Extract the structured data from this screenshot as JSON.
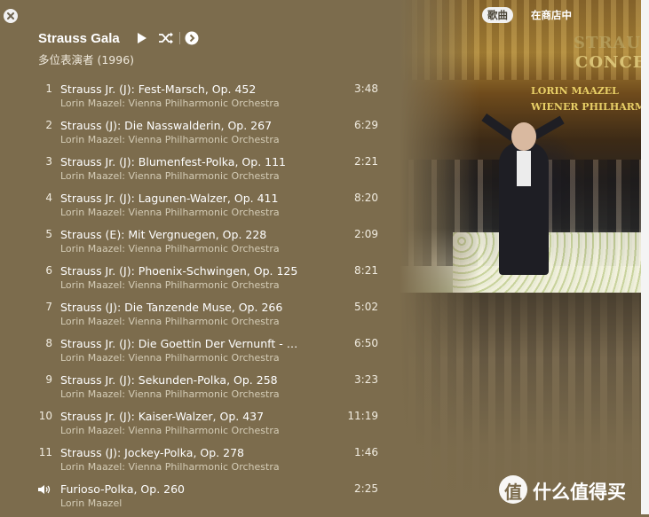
{
  "window": {
    "close_icon": "close-icon",
    "view_toggle": {
      "songs_label": "歌曲",
      "store_label": "在商店中"
    }
  },
  "album": {
    "title": "Strauss Gala",
    "subtitle": "多位表演者 (1996)",
    "art": {
      "title_line_1": "STRAUSS",
      "title_line_2": "CONCE",
      "credit_line_1": "LORIN MAAZEL",
      "credit_line_2": "WIENER PHILHARMONI"
    },
    "controls": {
      "play_icon": "play-icon",
      "shuffle_icon": "shuffle-icon",
      "next_icon": "chevron-right-circle-icon"
    }
  },
  "tracks": [
    {
      "number": "1",
      "title": "Strauss Jr. (J): Fest-Marsch, Op. 452",
      "artist": "Lorin Maazel: Vienna Philharmonic Orchestra",
      "duration": "3:48"
    },
    {
      "number": "2",
      "title": "Strauss (J): Die Nasswalderin, Op. 267",
      "artist": "Lorin Maazel: Vienna Philharmonic Orchestra",
      "duration": "6:29"
    },
    {
      "number": "3",
      "title": "Strauss Jr. (J): Blumenfest-Polka, Op. 111",
      "artist": "Lorin Maazel: Vienna Philharmonic Orchestra",
      "duration": "2:21"
    },
    {
      "number": "4",
      "title": "Strauss Jr. (J): Lagunen-Walzer, Op. 411",
      "artist": "Lorin Maazel: Vienna Philharmonic Orchestra",
      "duration": "8:20"
    },
    {
      "number": "5",
      "title": "Strauss (E): Mit Vergnuegen, Op. 228",
      "artist": "Lorin Maazel: Vienna Philharmonic Orchestra",
      "duration": "2:09"
    },
    {
      "number": "6",
      "title": "Strauss Jr. (J): Phoenix-Schwingen, Op. 125",
      "artist": "Lorin Maazel: Vienna Philharmonic Orchestra",
      "duration": "8:21"
    },
    {
      "number": "7",
      "title": "Strauss (J): Die Tanzende Muse, Op. 266",
      "artist": "Lorin Maazel: Vienna Philharmonic Orchestra",
      "duration": "5:02"
    },
    {
      "number": "8",
      "title": "Strauss Jr. (J): Die Goettin Der Vernunft - Ou...",
      "artist": "Lorin Maazel: Vienna Philharmonic Orchestra",
      "duration": "6:50"
    },
    {
      "number": "9",
      "title": "Strauss Jr. (J): Sekunden-Polka, Op. 258",
      "artist": "Lorin Maazel: Vienna Philharmonic Orchestra",
      "duration": "3:23"
    },
    {
      "number": "10",
      "title": "Strauss Jr. (J): Kaiser-Walzer, Op. 437",
      "artist": "Lorin Maazel: Vienna Philharmonic Orchestra",
      "duration": "11:19"
    },
    {
      "number": "11",
      "title": "Strauss (J): Jockey-Polka, Op. 278",
      "artist": "Lorin Maazel: Vienna Philharmonic Orchestra",
      "duration": "1:46"
    },
    {
      "number": "",
      "now_playing_icon": "speaker-icon",
      "title": "Furioso-Polka, Op. 260",
      "artist": "Lorin Maazel",
      "duration": "2:25"
    }
  ],
  "watermark": {
    "logo_char": "值",
    "text": "什么值得买"
  },
  "colors": {
    "background": "#7c6c4d",
    "text": "#ffffff",
    "secondary_text": "#d4ccb6"
  }
}
